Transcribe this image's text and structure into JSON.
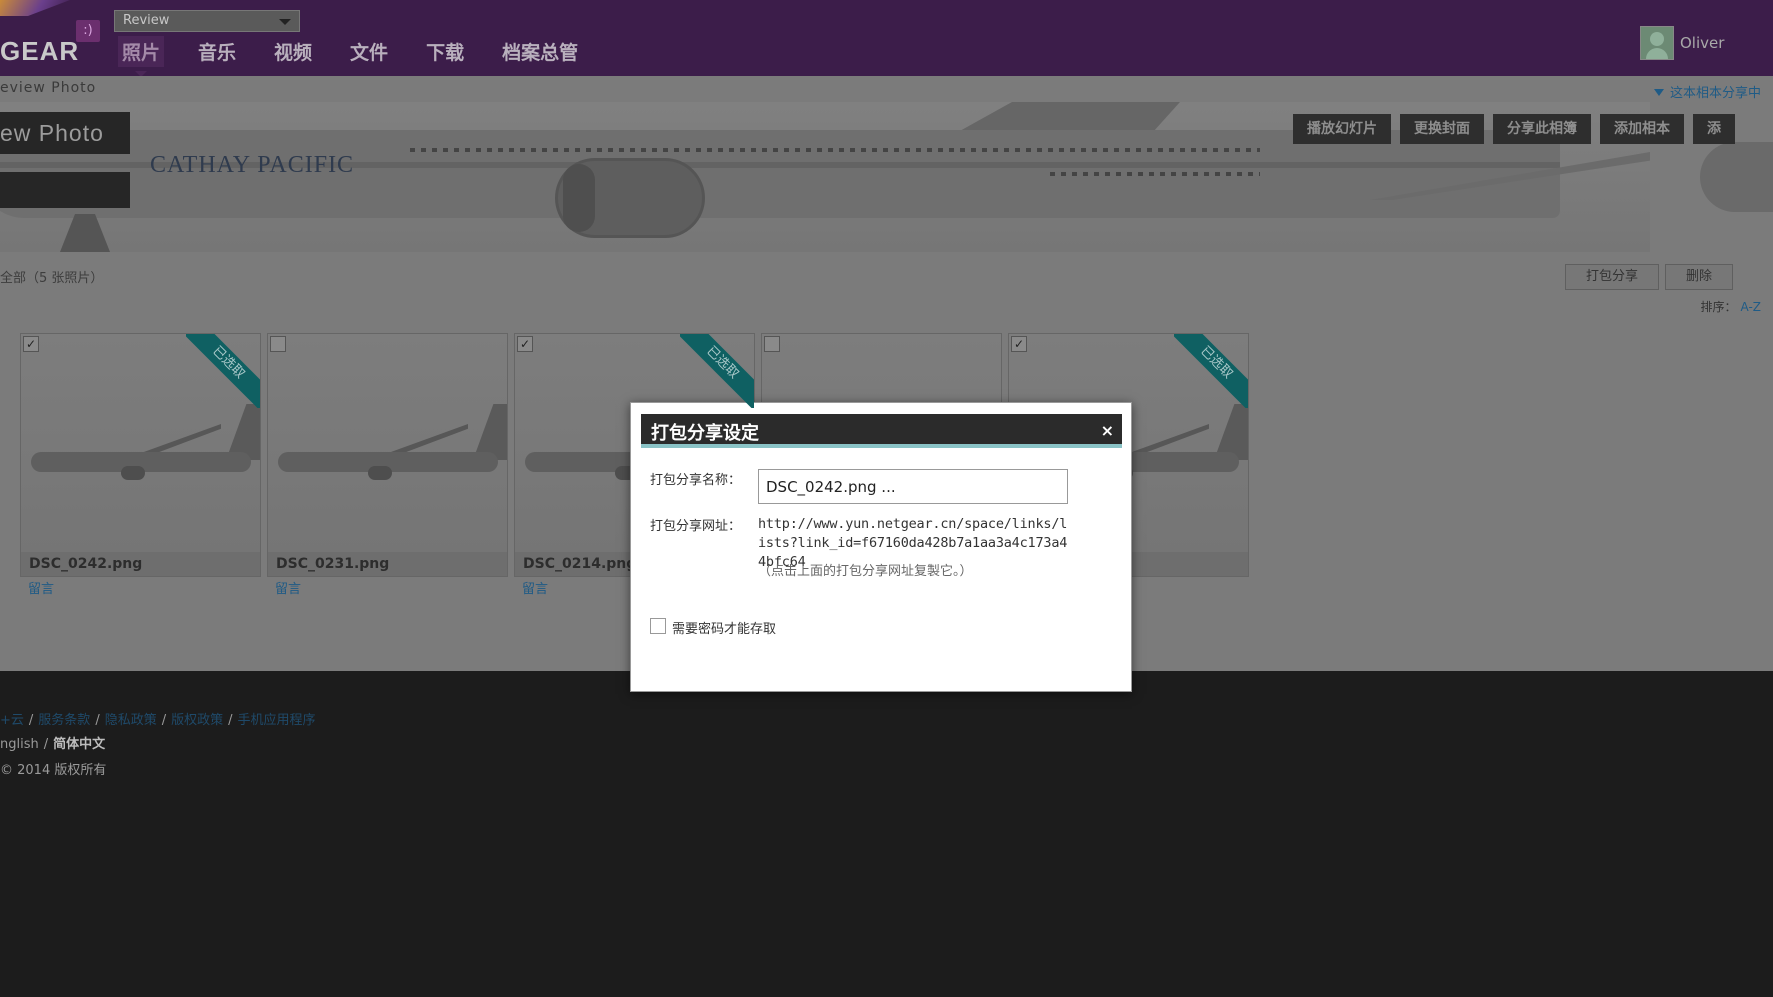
{
  "header": {
    "logo_text": "GEAR",
    "logo_badge": ":)",
    "view_select": "Review",
    "nav": [
      {
        "label": "照片",
        "active": true
      },
      {
        "label": "音乐",
        "active": false
      },
      {
        "label": "视频",
        "active": false
      },
      {
        "label": "文件",
        "active": false
      },
      {
        "label": "下载",
        "active": false
      },
      {
        "label": "档案总管",
        "active": false
      }
    ],
    "user_name": "Oliver"
  },
  "breadcrumb": "eview Photo",
  "share_status": "这本相本分享中",
  "banner": {
    "album_title": "ew Photo",
    "airline_text": "CATHAY PACIFIC",
    "buttons": [
      "播放幻灯片",
      "更换封面",
      "分享此相簿",
      "添加相本",
      "添"
    ]
  },
  "toolbar": {
    "count_label": "全部（5 张照片）",
    "pack_share": "打包分享",
    "delete": "删除",
    "sort_label": "排序：",
    "sort_value": "A-Z"
  },
  "photos": [
    {
      "name": "DSC_0242.png",
      "checked": true,
      "badge": "已选取",
      "comment": "留言"
    },
    {
      "name": "DSC_0231.png",
      "checked": false,
      "badge": "",
      "comment": "留言"
    },
    {
      "name": "DSC_0214.png",
      "checked": true,
      "badge": "已选取",
      "comment": "留言"
    },
    {
      "name": "",
      "checked": false,
      "badge": "",
      "comment": ""
    },
    {
      "name": "",
      "checked": true,
      "badge": "已选取",
      "comment": ""
    }
  ],
  "footer": {
    "links": [
      "+云",
      "服务条款",
      "隐私政策",
      "版权政策",
      "手机应用程序"
    ],
    "lang_english": "nglish",
    "lang_current": "简体中文",
    "copyright": "© 2014  版权所有"
  },
  "modal": {
    "title": "打包分享设定",
    "close": "×",
    "name_label": "打包分享名称：",
    "name_value": "DSC_0242.png ...",
    "url_label": "打包分享网址：",
    "url": "http://www.yun.netgear.cn/space/links/lists?link_id=f67160da428b7a1aa3a4c173a44bfc64",
    "hint": "（点击上面的打包分享网址复製它。）",
    "password_label": "需要密码才能存取",
    "password_checked": false
  }
}
